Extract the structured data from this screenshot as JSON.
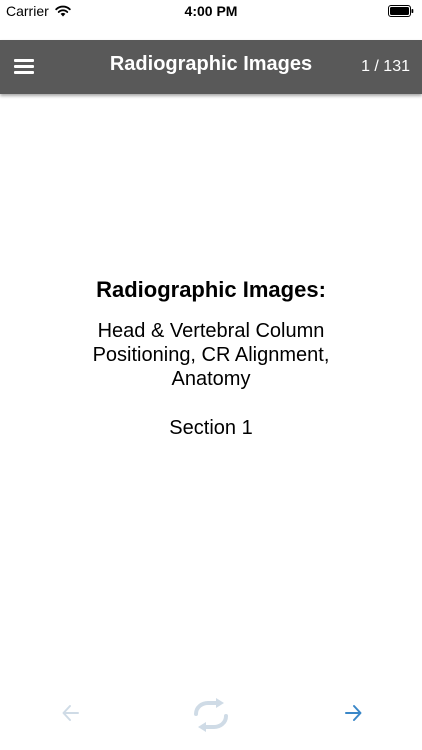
{
  "status_bar": {
    "carrier": "Carrier",
    "time": "4:00 PM",
    "icons": [
      "wifi-icon",
      "battery-icon"
    ]
  },
  "nav": {
    "title": "Radiographic Images",
    "page_counter": "1 / 131",
    "menu_icon": "hamburger-menu-icon"
  },
  "content": {
    "title": "Radiographic Images:",
    "lines": [
      "Head & Vertebral Column",
      "Positioning, CR Alignment,",
      "Anatomy"
    ],
    "section": "Section 1"
  },
  "toolbar": {
    "prev_icon": "arrow-left-icon",
    "refresh_icon": "refresh-icon",
    "next_icon": "arrow-right-icon"
  },
  "colors": {
    "nav_background": "#595959",
    "disabled_icon": "#cfdbe6",
    "active_icon": "#3a87c8"
  }
}
